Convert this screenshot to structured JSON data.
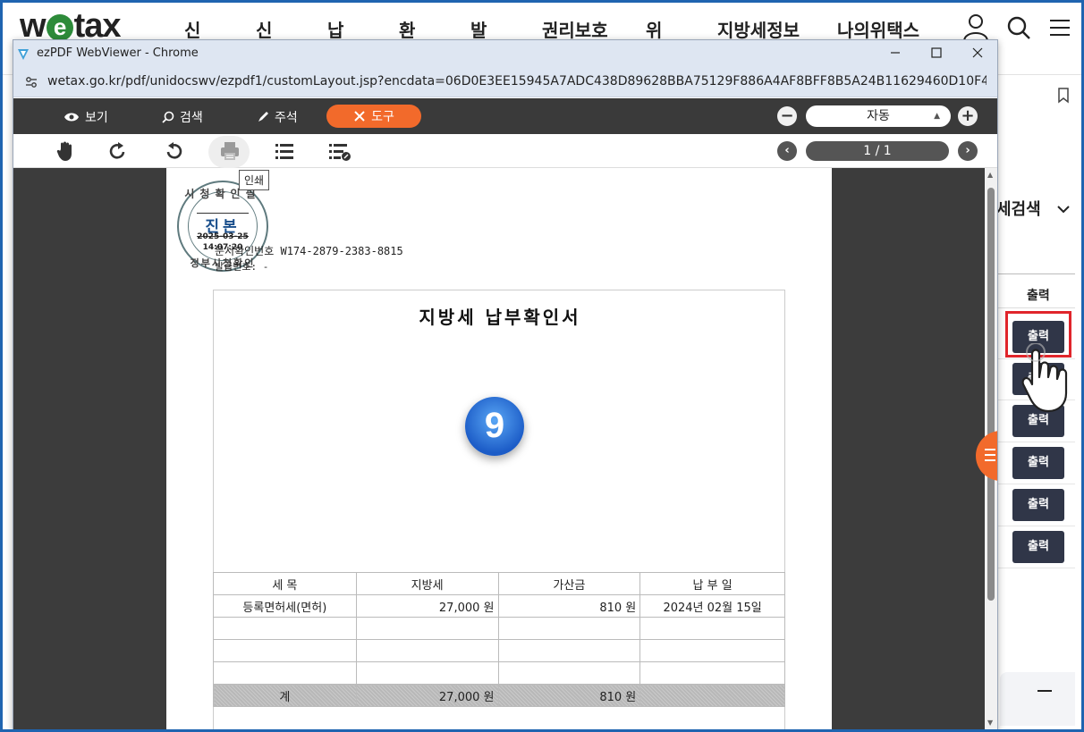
{
  "wetax": {
    "logo": "wetax",
    "logo_prefix": "w",
    "logo_e": "e",
    "logo_suffix": "tax",
    "nav": [
      "신고",
      "신청",
      "납부",
      "환급",
      "발급",
      "권리보호",
      "위임",
      "지방세정보",
      "나의위택스"
    ],
    "search_label": "세검색",
    "column_header": "출력",
    "output_buttons": [
      "출력",
      "출력",
      "출력",
      "출력",
      "출력",
      "출력"
    ]
  },
  "window": {
    "title": "ezPDF WebViewer - Chrome",
    "url": "wetax.go.kr/pdf/unidocswv/ezpdf1/customLayout.jsp?encdata=06D0E3EE15945A7ADC438D89628BBA75129F886A4AF8BFF8B5A24B11629460D10F45BEAB4AEB756..."
  },
  "viewer": {
    "toolbar": {
      "view_label": "보기",
      "search_label": "검색",
      "annotate_label": "주석",
      "tools_label": "도구",
      "zoom_value": "자동",
      "page_indicator": "1 / 1"
    },
    "tooltip": "인쇄"
  },
  "document": {
    "seal": {
      "top": "시청확인필",
      "main": "진본",
      "date": "2025-03-25",
      "time": "14:07:20",
      "bottom": "정부시청확인"
    },
    "doc_number": "문서확인번호 W174-2879-2383-8815",
    "issue_number": "발급번호: -",
    "title": "지방세 납부확인서",
    "step_number": "9",
    "table": {
      "headers": [
        "세 목",
        "지방세",
        "가산금",
        "납 부 일"
      ],
      "rows": [
        [
          "등록면허세(면허)",
          "27,000 원",
          "810 원",
          "2024년 02월 15일"
        ],
        [
          "",
          "",
          "",
          ""
        ],
        [
          "",
          "",
          "",
          ""
        ],
        [
          "",
          "",
          "",
          ""
        ]
      ],
      "total": [
        "계",
        "27,000 원",
        "810 원",
        ""
      ]
    }
  },
  "colors": {
    "accent_orange": "#f26a2b",
    "toolbar_dark": "#3a3a3a",
    "button_navy": "#303648",
    "highlight_red": "#e0252b",
    "frame_blue": "#1f64b0"
  }
}
